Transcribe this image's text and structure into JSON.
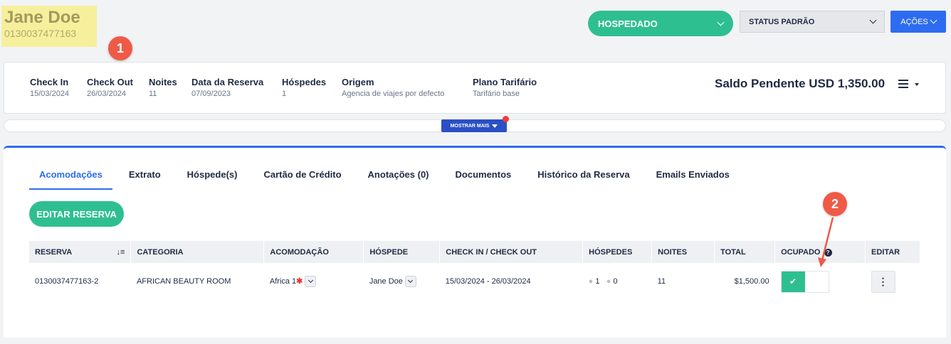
{
  "guest": {
    "name": "Jane Doe",
    "id": "0130037477163"
  },
  "annotations": {
    "badge1": "1",
    "badge2": "2"
  },
  "header": {
    "status_label": "HOSPEDADO",
    "standard_status_label": "STATUS PADRÃO",
    "actions_label": "AÇÕES"
  },
  "info": {
    "check_in": {
      "label": "Check In",
      "value": "15/03/2024"
    },
    "check_out": {
      "label": "Check Out",
      "value": "26/03/2024"
    },
    "nights": {
      "label": "Noites",
      "value": "11"
    },
    "booking_date": {
      "label": "Data da Reserva",
      "value": "07/09/2023"
    },
    "guests": {
      "label": "Hóspedes",
      "value": "1"
    },
    "origin": {
      "label": "Origem",
      "value": "Agencia de viajes por defecto"
    },
    "rate_plan": {
      "label": "Plano Tarifário",
      "value": "Tarifário base"
    },
    "balance": "Saldo Pendente USD 1,350.00"
  },
  "show_more_label": "MOSTRAR MAIS",
  "tabs": [
    {
      "label": "Acomodações"
    },
    {
      "label": "Extrato"
    },
    {
      "label": "Hóspede(s)"
    },
    {
      "label": "Cartão de Crédito"
    },
    {
      "label": "Anotações (0)"
    },
    {
      "label": "Documentos"
    },
    {
      "label": "Histórico da Reserva"
    },
    {
      "label": "Emails Enviados"
    }
  ],
  "edit_reservation_label": "EDITAR RESERVA",
  "table": {
    "headers": {
      "reserva": "RESERVA",
      "categoria": "CATEGORIA",
      "acomodacao": "ACOMODAÇÃO",
      "hospede": "HÓSPEDE",
      "check": "CHECK IN / CHECK OUT",
      "hospedes": "HÓSPEDES",
      "noites": "NOITES",
      "total": "TOTAL",
      "ocupado": "OCUPADO",
      "editar": "EDITAR"
    },
    "row": {
      "reserva": "0130037477163-2",
      "categoria": "AFRICAN BEAUTY ROOM",
      "acomodacao": "Africa 1",
      "hospede": "Jane Doe",
      "check": "15/03/2024 - 26/03/2024",
      "adults": "1",
      "children": "0",
      "noites": "11",
      "total": "$1,500.00"
    }
  },
  "colors": {
    "accent": "#2d6cf0",
    "green": "#2ebf91",
    "highlight": "#f6ef9c",
    "badge": "#ef5a47"
  }
}
